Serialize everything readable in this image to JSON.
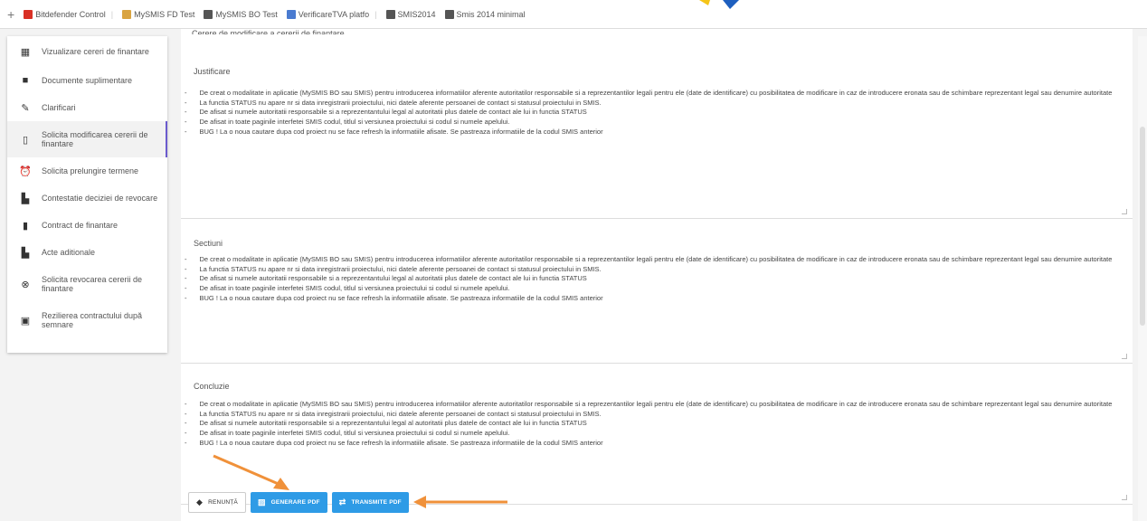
{
  "bookmarks": [
    {
      "label": "Bitdefender Control",
      "color": "#d93025"
    },
    {
      "label": "MySMIS FD Test",
      "color": "#d9a441"
    },
    {
      "label": "MySMIS BO Test",
      "color": "#333333"
    },
    {
      "label": "VerificareTVA platfo",
      "color": "#4a7bd0"
    },
    {
      "label": "SMIS2014",
      "color": "#333333"
    },
    {
      "label": "Smis 2014 minimal",
      "color": "#333333"
    }
  ],
  "sidebar": {
    "items": [
      {
        "label": "Vizualizare cereri de finantare",
        "icon": "grid-icon"
      },
      {
        "label": "Documente suplimentare",
        "icon": "document-icon"
      },
      {
        "label": "Clarificari",
        "icon": "edit-icon"
      },
      {
        "label": "Solicita modificarea cererii de finantare",
        "icon": "file-edit-icon"
      },
      {
        "label": "Solicita prelungire termene",
        "icon": "alarm-icon"
      },
      {
        "label": "Contestatie deciziei de revocare",
        "icon": "file-icon"
      },
      {
        "label": "Contract de finantare",
        "icon": "contract-icon"
      },
      {
        "label": "Acte aditionale",
        "icon": "file-plus-icon"
      },
      {
        "label": "Solicita revocarea cererii de finantare",
        "icon": "cancel-icon"
      },
      {
        "label": "Rezilierea contractului după semnare",
        "icon": "terminate-icon"
      }
    ]
  },
  "top_label": "Cerere de modificare a cererii de finantare",
  "sections": [
    {
      "title": "Justificare"
    },
    {
      "title": "Sectiuni"
    },
    {
      "title": "Concluzie"
    }
  ],
  "body_lines": [
    "De creat o modalitate in aplicatie (MySMIS BO sau SMIS) pentru introducerea informatiilor aferente autoritatilor responsabile si a reprezentantilor legali pentru ele (date de identificare) cu posibilitatea de modificare in caz de introducere eronata sau de schimbare reprezentant legal sau denumire autoritate",
    "La functia STATUS nu apare nr si data inregistrarii proiectului, nici datele aferente persoanei de contact si statusul proiectului in SMIS.",
    "De afisat si numele autoritatii responsabile si a reprezentantului legal al autoritatii plus datele de contact ale lui in functia STATUS",
    "De afisat in toate paginile interfetei SMIS codul, titlul si versiunea proiectului si codul si numele apelului.",
    "BUG ! La o noua cautare dupa cod proiect nu se face refresh la informatiile afisate. Se pastreaza informatiile de la codul SMIS anterior"
  ],
  "buttons": {
    "back": "RENUNȚĂ",
    "generate": "GENERARE PDF",
    "transmit": "TRANSMITE PDF"
  },
  "colors": {
    "accent_blue": "#2e9be6",
    "arrow_orange": "#f0913a",
    "active_indicator": "#6a5acd"
  }
}
